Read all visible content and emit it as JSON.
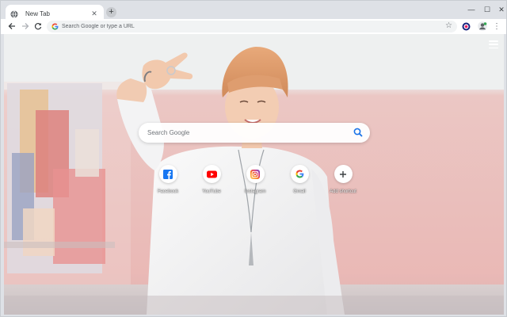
{
  "browser": {
    "tab": {
      "title": "New Tab",
      "close_glyph": "✕"
    },
    "new_tab_glyph": "+",
    "window_controls": {
      "minimize": "—",
      "maximize": "☐",
      "close": "✕"
    },
    "omnibox": {
      "placeholder": "Search Google or type a URL"
    },
    "menu_glyph": "⋮"
  },
  "page": {
    "search": {
      "placeholder": "Search Google"
    },
    "shortcuts": [
      {
        "label": "Facebook",
        "icon": "facebook-icon",
        "color": "#1877f2"
      },
      {
        "label": "YouTube",
        "icon": "youtube-icon",
        "color": "#ff0000"
      },
      {
        "label": "Instagram",
        "icon": "instagram-icon",
        "color": "#c13584"
      },
      {
        "label": "Gmail",
        "icon": "google-icon",
        "color": "#4285f4"
      },
      {
        "label": "Add shortcut",
        "icon": "plus-icon",
        "color": "#3c4043"
      }
    ]
  },
  "colors": {
    "tabstrip": "#dee1e6",
    "search_blue": "#1a73e8",
    "wall_pink": "#eab9b6"
  }
}
